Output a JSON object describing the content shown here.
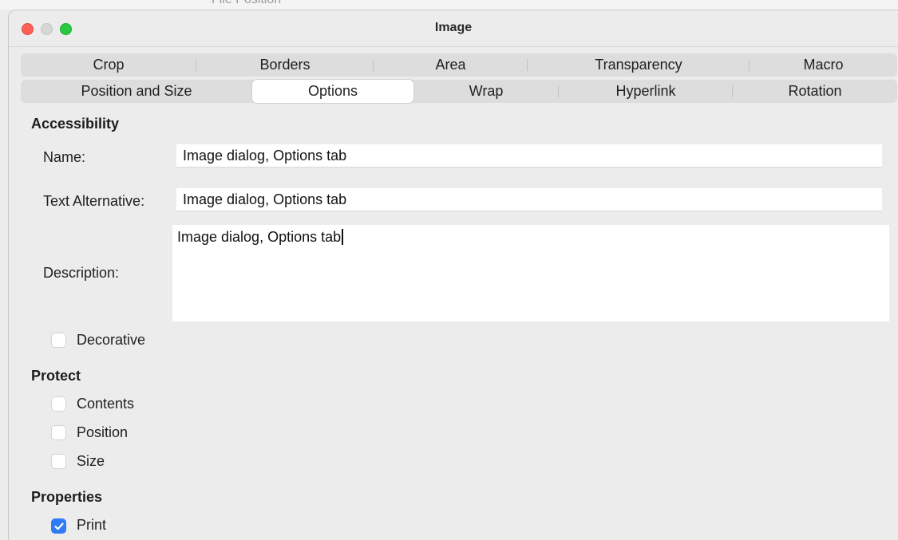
{
  "background_text": "File  Position",
  "window": {
    "title": "Image"
  },
  "tabs_row1": [
    "Crop",
    "Borders",
    "Area",
    "Transparency",
    "Macro"
  ],
  "tabs_row2": [
    "Position and Size",
    "Options",
    "Wrap",
    "Hyperlink",
    "Rotation"
  ],
  "active_tab": "Options",
  "accessibility": {
    "heading": "Accessibility",
    "name_label": "Name:",
    "name_value": "Image dialog, Options tab",
    "alt_label": "Text Alternative:",
    "alt_value": "Image dialog, Options tab",
    "desc_label": "Description:",
    "desc_value": "Image dialog, Options tab",
    "decorative_label": "Decorative",
    "decorative_checked": false
  },
  "protect": {
    "heading": "Protect",
    "contents_label": "Contents",
    "contents_checked": false,
    "position_label": "Position",
    "position_checked": false,
    "size_label": "Size",
    "size_checked": false
  },
  "properties": {
    "heading": "Properties",
    "print_label": "Print",
    "print_checked": true
  },
  "colors": {
    "accent": "#2f7bf5",
    "close": "#fe5f57",
    "zoom": "#28c840",
    "minimize": "#d7d7d7"
  }
}
